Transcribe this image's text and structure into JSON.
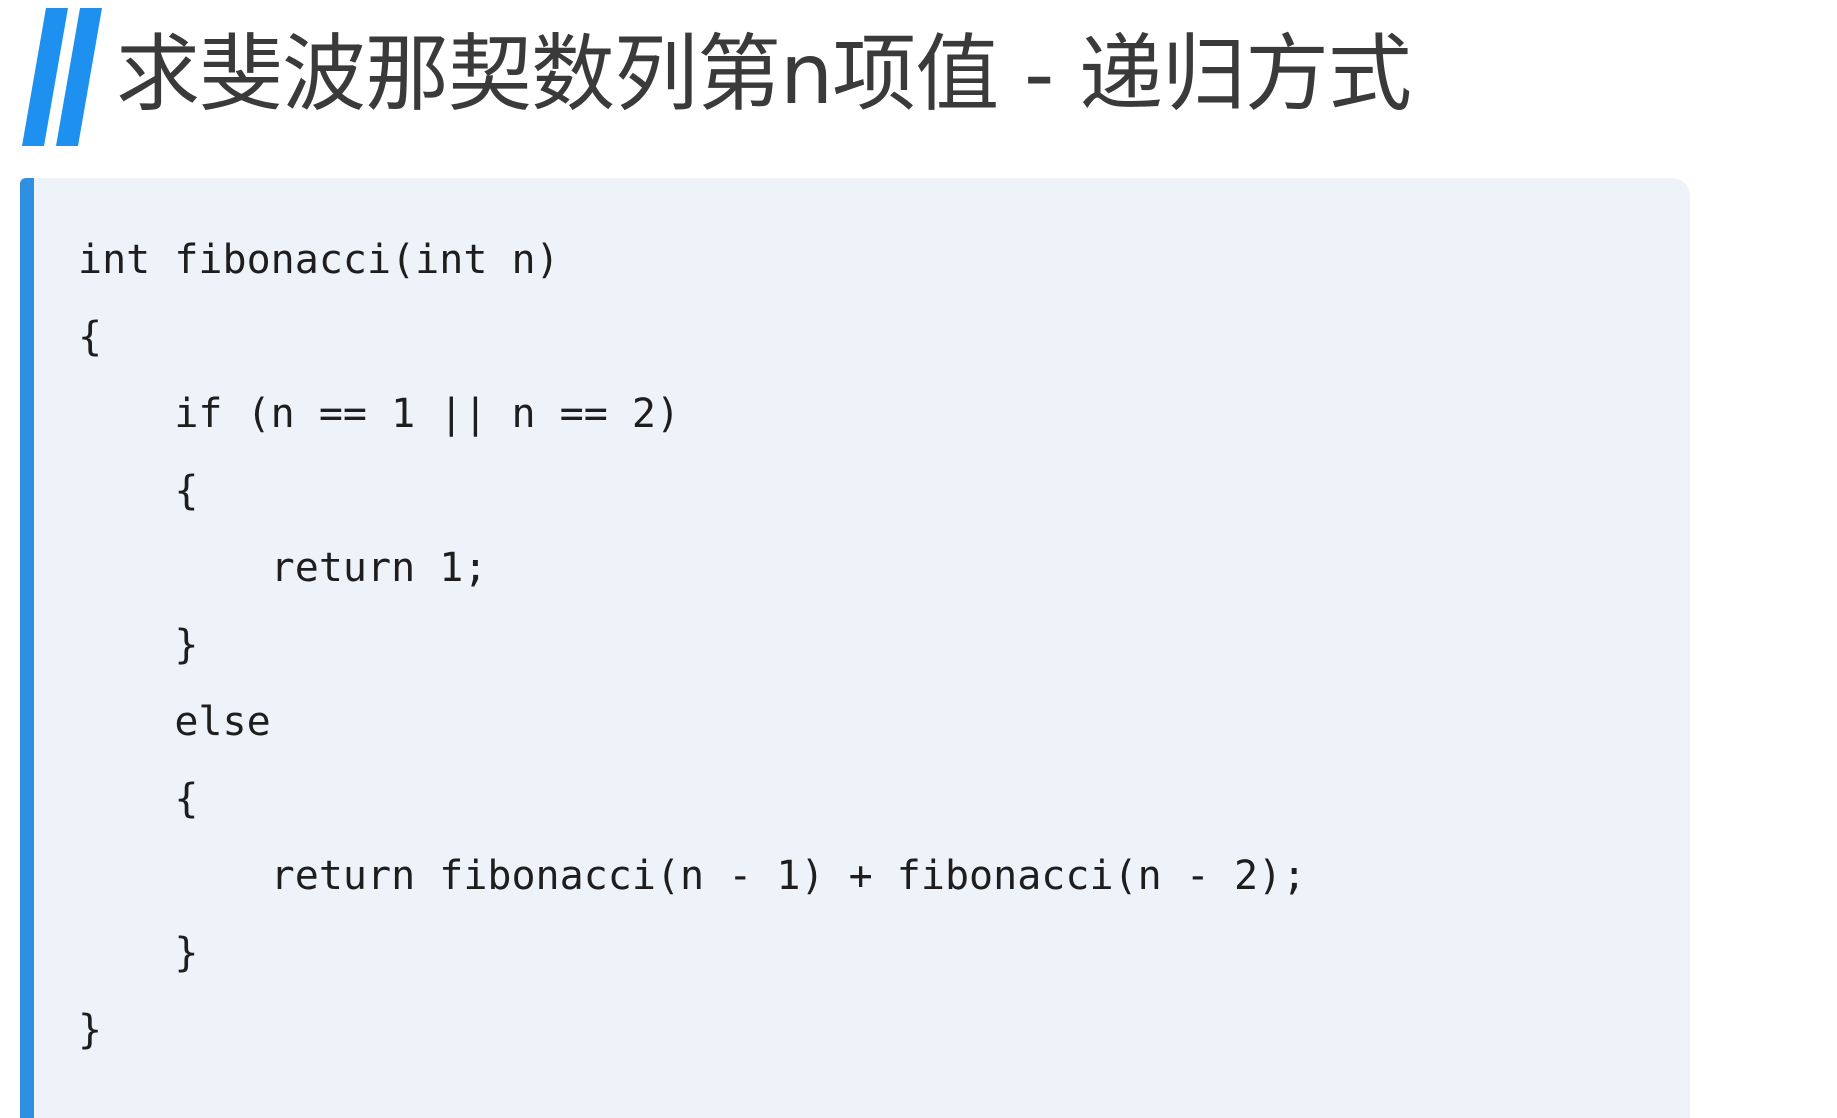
{
  "slide": {
    "title": "求斐波那契数列第n项值 - 递归方式",
    "accent_color": "#1e90f0",
    "bars_icon": "double-slash-bars"
  },
  "code": {
    "language": "c",
    "panel_color": "#eef3fa",
    "accent_color": "#2f8fe0",
    "lines": [
      "int fibonacci(int n)",
      "{",
      "    if (n == 1 || n == 2)",
      "    {",
      "        return 1;",
      "    }",
      "    else",
      "    {",
      "        return fibonacci(n - 1) + fibonacci(n - 2);",
      "    }",
      "}"
    ]
  }
}
